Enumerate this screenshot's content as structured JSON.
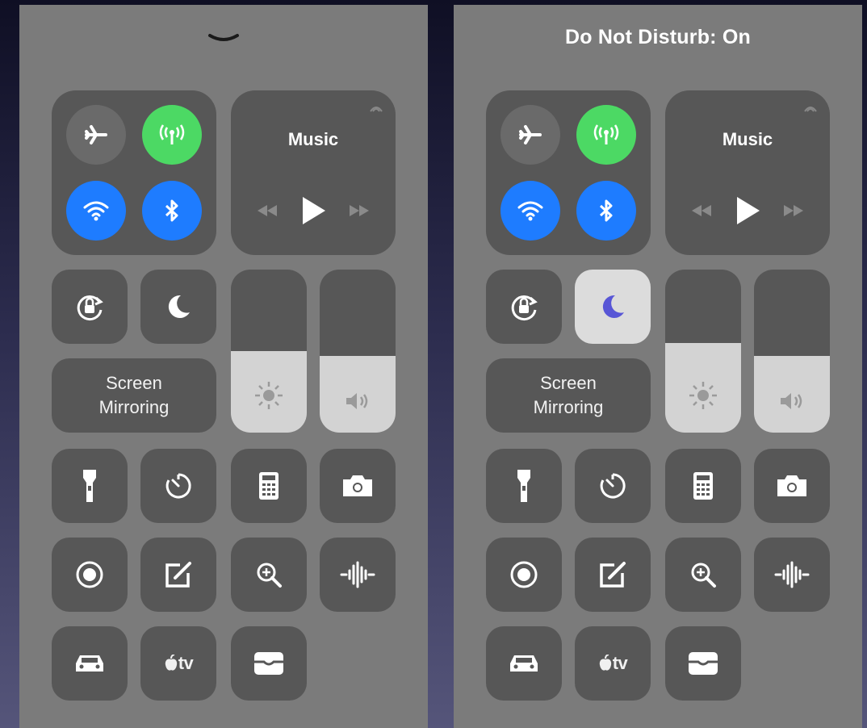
{
  "colors": {
    "accent_green": "#4cd964",
    "accent_blue": "#1e7cff",
    "dnd_active": "#5856d6"
  },
  "left_panel": {
    "header_icon": "chevron-down-icon",
    "music": {
      "title": "Music"
    },
    "screen_mirroring": {
      "line1": "Screen",
      "line2": "Mirroring"
    },
    "do_not_disturb_active": false,
    "brightness_level": 0.5,
    "volume_level": 0.47
  },
  "right_panel": {
    "status": "Do Not Disturb: On",
    "music": {
      "title": "Music"
    },
    "screen_mirroring": {
      "line1": "Screen",
      "line2": "Mirroring"
    },
    "do_not_disturb_active": true,
    "brightness_level": 0.55,
    "volume_level": 0.47
  },
  "icons": [
    "airplane-mode-icon",
    "cellular-data-icon",
    "wifi-icon",
    "bluetooth-icon",
    "airplay-icon",
    "rewind-icon",
    "play-icon",
    "fast-forward-icon",
    "orientation-lock-icon",
    "moon-icon",
    "sun-icon",
    "speaker-icon",
    "flashlight-icon",
    "timer-icon",
    "calculator-icon",
    "camera-icon",
    "screen-recording-icon",
    "notes-icon",
    "magnifier-icon",
    "voice-memos-icon",
    "car-icon",
    "apple-tv-remote-icon",
    "wallet-icon"
  ],
  "apple_tv_label": "tv"
}
